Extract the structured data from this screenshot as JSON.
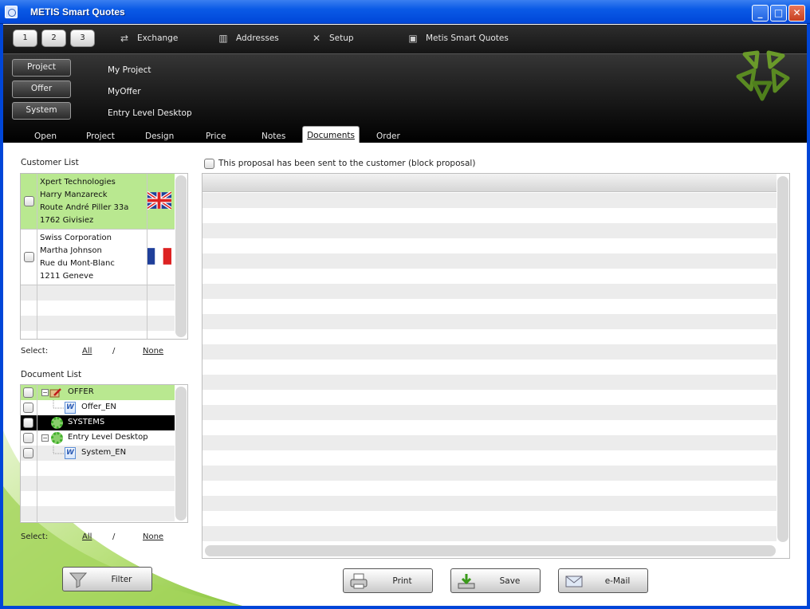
{
  "window": {
    "title": "METIS Smart Quotes",
    "minimize": "_",
    "maximize": "□",
    "close": "✕"
  },
  "menubar": {
    "numbers": [
      "1",
      "2",
      "3"
    ],
    "items": [
      {
        "label": "Exchange",
        "icon": "exchange-icon"
      },
      {
        "label": "Addresses",
        "icon": "addresses-icon"
      },
      {
        "label": "Setup",
        "icon": "setup-tools-icon"
      },
      {
        "label": "Metis Smart Quotes",
        "icon": "metis-app-icon"
      }
    ]
  },
  "context": [
    {
      "button": "Project",
      "value": "My Project"
    },
    {
      "button": "Offer",
      "value": "MyOffer"
    },
    {
      "button": "System",
      "value": "Entry Level Desktop"
    }
  ],
  "tabs": [
    "Open",
    "Project",
    "Design",
    "Price",
    "Notes",
    "Documents",
    "Order"
  ],
  "active_tab": "Documents",
  "customer_list": {
    "label": "Customer List",
    "customers": [
      {
        "lines": [
          "Xpert Technologies",
          "Harry Manzareck",
          "Route André Piller 33a",
          "1762 Givisiez"
        ],
        "flag": "uk-flag-icon",
        "selected": true
      },
      {
        "lines": [
          "Swiss Corporation",
          "Martha Johnson",
          "Rue du Mont-Blanc",
          "1211 Geneve"
        ],
        "flag": "france-flag-icon",
        "selected": false
      }
    ]
  },
  "select": {
    "label": "Select:",
    "all": "All",
    "separator": "/",
    "none": "None"
  },
  "document_list": {
    "label": "Document List",
    "items": [
      {
        "label": "OFFER",
        "level": 0,
        "icon": "offer-icon",
        "highlight": "green"
      },
      {
        "label": "Offer_EN",
        "level": 1,
        "icon": "word-doc-icon",
        "highlight": "none"
      },
      {
        "label": "SYSTEMS",
        "level": 0,
        "icon": "gear-icon",
        "highlight": "black"
      },
      {
        "label": "Entry Level Desktop",
        "level": 0,
        "icon": "gear-icon",
        "highlight": "none"
      },
      {
        "label": "System_EN",
        "level": 1,
        "icon": "word-doc-icon",
        "highlight": "none"
      }
    ]
  },
  "proposal_checkbox_label": "This proposal has been sent to the customer (block proposal)",
  "buttons": {
    "filter": "Filter",
    "print": "Print",
    "save": "Save",
    "email": "e-Mail"
  },
  "colors": {
    "titlebar": "#0a5ae6",
    "selected_row": "#b9e890",
    "black_row": "#000000",
    "logo": "#6a9a2a"
  }
}
